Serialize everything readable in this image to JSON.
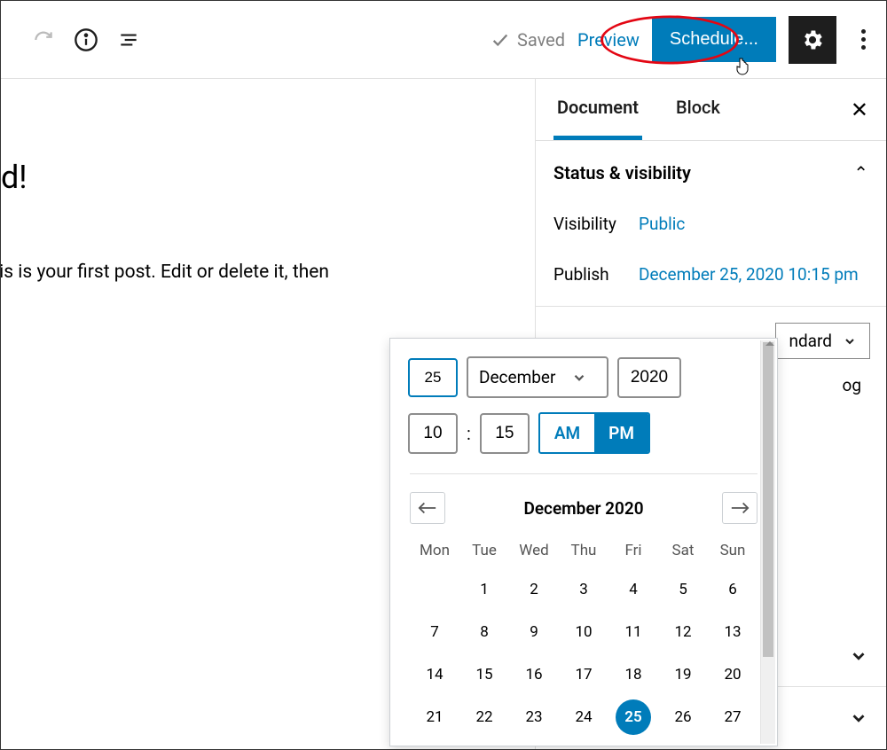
{
  "toolbar": {
    "saved_label": "Saved",
    "preview_label": "Preview",
    "schedule_label": "Schedule..."
  },
  "editor": {
    "title_fragment": "d!",
    "content_fragment": "ordPress. This is your first post. Edit or delete it, then"
  },
  "sidebar": {
    "tabs": {
      "document": "Document",
      "block": "Block"
    },
    "panel_status_title": "Status & visibility",
    "visibility_label": "Visibility",
    "visibility_value": "Public",
    "publish_label": "Publish",
    "publish_value": "December 25, 2020 10:15 pm",
    "format_value": "ndard",
    "other_fragment": "og"
  },
  "datetime": {
    "day": "25",
    "month": "December",
    "year": "2020",
    "hour": "10",
    "minute": "15",
    "am": "AM",
    "pm": "PM",
    "month_year": "December 2020",
    "dow": [
      "Mon",
      "Tue",
      "Wed",
      "Thu",
      "Fri",
      "Sat",
      "Sun"
    ],
    "days_row1": [
      "",
      "1",
      "2",
      "3",
      "4",
      "5",
      "6"
    ],
    "days_row2": [
      "7",
      "8",
      "9",
      "10",
      "11",
      "12",
      "13"
    ],
    "days_row3": [
      "14",
      "15",
      "16",
      "17",
      "18",
      "19",
      "20"
    ],
    "days_row4": [
      "21",
      "22",
      "23",
      "24",
      "25",
      "26",
      "27"
    ],
    "selected_day": "25"
  }
}
